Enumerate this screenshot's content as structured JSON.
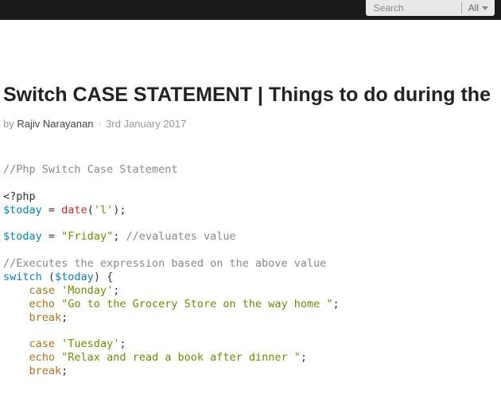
{
  "header": {
    "search_placeholder": "Search",
    "filter_label": "All"
  },
  "article": {
    "title": "Switch CASE STATEMENT | Things to do during the",
    "by_label": "by",
    "author": "Rajiv Narayanan",
    "dot": "·",
    "date": "3rd January 2017"
  },
  "code": {
    "l1_comment": "//Php Switch Case Statement",
    "l2_open": "<?php",
    "l3_var": "$today",
    "l3_eq": " = ",
    "l3_func": "date",
    "l3_paren_o": "(",
    "l3_arg": "'l'",
    "l3_paren_c": ");",
    "l5_var": "$today",
    "l5_eq": " = ",
    "l5_val": "\"Friday\"",
    "l5_semi": "; ",
    "l5_comment": "//evaluates value",
    "l7_comment": "//Executes the expression based on the above value",
    "l8_switch": "switch",
    "l8_paren_o": " (",
    "l8_var": "$today",
    "l8_paren_c": ") {",
    "l9_indent": "    ",
    "l9_case": "case",
    "l9_space": " ",
    "l9_val": "'Monday'",
    "l9_semi": ";",
    "l10_indent": "    ",
    "l10_echo": "echo",
    "l10_space": " ",
    "l10_str": "\"Go to the Grocery Store on the way home \"",
    "l10_semi": ";",
    "l11_indent": "    ",
    "l11_break": "break",
    "l11_semi": ";",
    "l13_indent": "    ",
    "l13_case": "case",
    "l13_space": " ",
    "l13_val": "'Tuesday'",
    "l13_semi": ";",
    "l14_indent": "    ",
    "l14_echo": "echo",
    "l14_space": " ",
    "l14_str": "\"Relax and read a book after dinner \"",
    "l14_semi": ";",
    "l15_indent": "    ",
    "l15_break": "break",
    "l15_semi": ";"
  }
}
